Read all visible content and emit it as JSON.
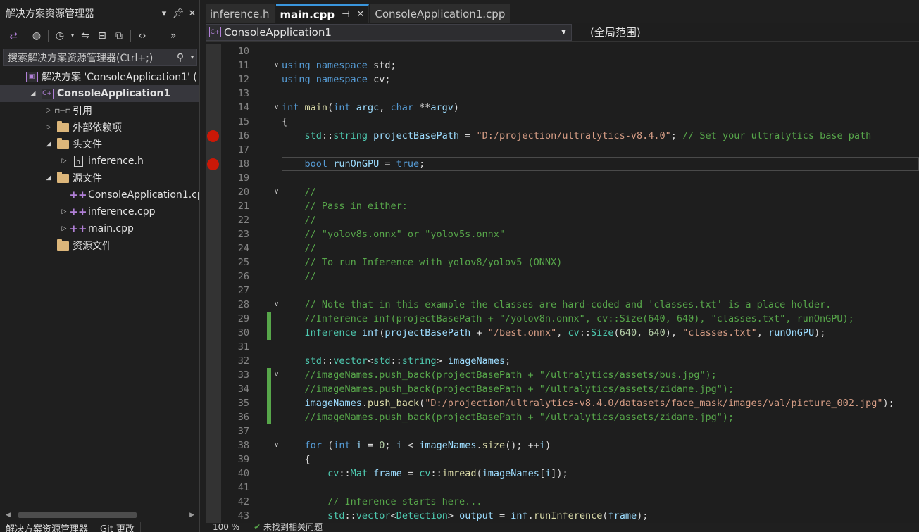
{
  "solution_explorer": {
    "title": "解决方案资源管理器",
    "search_placeholder": "搜索解决方案资源管理器(Ctrl+;)",
    "tree": [
      {
        "label": "解决方案 'ConsoleApplication1' (",
        "icon": "solution-icon",
        "indent": 0,
        "twisty": "",
        "bold": false
      },
      {
        "label": "ConsoleApplication1",
        "icon": "project-icon",
        "indent": 1,
        "twisty": "open",
        "bold": true
      },
      {
        "label": "引用",
        "icon": "references-icon",
        "indent": 2,
        "twisty": "closed",
        "bold": false
      },
      {
        "label": "外部依赖项",
        "icon": "external-deps-icon",
        "indent": 2,
        "twisty": "closed",
        "bold": false
      },
      {
        "label": "头文件",
        "icon": "folder-icon",
        "indent": 2,
        "twisty": "open",
        "bold": false
      },
      {
        "label": "inference.h",
        "icon": "header-file-icon",
        "indent": 3,
        "twisty": "closed",
        "bold": false
      },
      {
        "label": "源文件",
        "icon": "folder-icon",
        "indent": 2,
        "twisty": "open",
        "bold": false
      },
      {
        "label": "ConsoleApplication1.cp",
        "icon": "cpp-file-icon",
        "indent": 3,
        "twisty": "",
        "bold": false
      },
      {
        "label": "inference.cpp",
        "icon": "cpp-file-icon",
        "indent": 3,
        "twisty": "closed",
        "bold": false
      },
      {
        "label": "main.cpp",
        "icon": "cpp-file-icon",
        "indent": 3,
        "twisty": "closed",
        "bold": false
      },
      {
        "label": "资源文件",
        "icon": "folder-icon",
        "indent": 2,
        "twisty": "",
        "bold": false
      }
    ],
    "bottom_tabs": [
      "解决方案资源管理器",
      "Git 更改"
    ]
  },
  "editor": {
    "tabs": [
      {
        "label": "inference.h",
        "active": false
      },
      {
        "label": "main.cpp",
        "active": true
      },
      {
        "label": "ConsoleApplication1.cpp",
        "active": false
      }
    ],
    "nav_project": "ConsoleApplication1",
    "nav_scope": "(全局范围)",
    "lines": [
      {
        "n": "10",
        "indent": 0,
        "segs": []
      },
      {
        "n": "11",
        "indent": 0,
        "fold": true,
        "segs": [
          [
            "kw",
            "using"
          ],
          [
            "pl",
            " "
          ],
          [
            "kw",
            "namespace"
          ],
          [
            "pl",
            " std;"
          ]
        ]
      },
      {
        "n": "12",
        "indent": 0,
        "segs": [
          [
            "kw",
            "using"
          ],
          [
            "pl",
            " "
          ],
          [
            "kw",
            "namespace"
          ],
          [
            "pl",
            " cv;"
          ]
        ]
      },
      {
        "n": "13",
        "indent": 0,
        "segs": []
      },
      {
        "n": "14",
        "indent": 0,
        "fold": true,
        "segs": [
          [
            "kw",
            "int"
          ],
          [
            "pl",
            " "
          ],
          [
            "fn",
            "main"
          ],
          [
            "pl",
            "("
          ],
          [
            "kw",
            "int"
          ],
          [
            "pl",
            " "
          ],
          [
            "vr",
            "argc"
          ],
          [
            "pl",
            ", "
          ],
          [
            "kw",
            "char"
          ],
          [
            "pl",
            " **"
          ],
          [
            "vr",
            "argv"
          ],
          [
            "pl",
            ")"
          ]
        ]
      },
      {
        "n": "15",
        "indent": 0,
        "segs": [
          [
            "pl",
            "{"
          ]
        ]
      },
      {
        "n": "16",
        "indent": 1,
        "bp": true,
        "segs": [
          [
            "ty",
            "std"
          ],
          [
            "pl",
            "::"
          ],
          [
            "ty",
            "string"
          ],
          [
            "pl",
            " "
          ],
          [
            "vr",
            "projectBasePath"
          ],
          [
            "pl",
            " = "
          ],
          [
            "st",
            "\"D:/projection/ultralytics-v8.4.0\""
          ],
          [
            "pl",
            "; "
          ],
          [
            "cm",
            "// Set your ultralytics base path"
          ]
        ]
      },
      {
        "n": "17",
        "indent": 1,
        "segs": []
      },
      {
        "n": "18",
        "indent": 1,
        "bp": true,
        "cur": true,
        "segs": [
          [
            "kw",
            "bool"
          ],
          [
            "pl",
            " "
          ],
          [
            "vr",
            "runOnGPU"
          ],
          [
            "pl",
            " = "
          ],
          [
            "kw",
            "true"
          ],
          [
            "pl",
            ";"
          ]
        ]
      },
      {
        "n": "19",
        "indent": 1,
        "segs": []
      },
      {
        "n": "20",
        "indent": 1,
        "fold": true,
        "segs": [
          [
            "cm",
            "//"
          ]
        ]
      },
      {
        "n": "21",
        "indent": 1,
        "segs": [
          [
            "cm",
            "// Pass in either:"
          ]
        ]
      },
      {
        "n": "22",
        "indent": 1,
        "segs": [
          [
            "cm",
            "//"
          ]
        ]
      },
      {
        "n": "23",
        "indent": 1,
        "segs": [
          [
            "cm",
            "// \"yolov8s.onnx\" or \"yolov5s.onnx\""
          ]
        ]
      },
      {
        "n": "24",
        "indent": 1,
        "segs": [
          [
            "cm",
            "//"
          ]
        ]
      },
      {
        "n": "25",
        "indent": 1,
        "segs": [
          [
            "cm",
            "// To run Inference with yolov8/yolov5 (ONNX)"
          ]
        ]
      },
      {
        "n": "26",
        "indent": 1,
        "segs": [
          [
            "cm",
            "//"
          ]
        ]
      },
      {
        "n": "27",
        "indent": 1,
        "segs": []
      },
      {
        "n": "28",
        "indent": 1,
        "fold": true,
        "segs": [
          [
            "cm",
            "// Note that in this example the classes are hard-coded and 'classes.txt' is a place holder."
          ]
        ]
      },
      {
        "n": "29",
        "indent": 1,
        "chg": true,
        "segs": [
          [
            "cm",
            "//Inference inf(projectBasePath + \"/yolov8n.onnx\", cv::Size(640, 640), \"classes.txt\", runOnGPU);"
          ]
        ]
      },
      {
        "n": "30",
        "indent": 1,
        "chg": true,
        "segs": [
          [
            "ty",
            "Inference"
          ],
          [
            "pl",
            " "
          ],
          [
            "vr",
            "inf"
          ],
          [
            "pl",
            "("
          ],
          [
            "vr",
            "projectBasePath"
          ],
          [
            "pl",
            " + "
          ],
          [
            "st",
            "\"/best.onnx\""
          ],
          [
            "pl",
            ", "
          ],
          [
            "ty",
            "cv"
          ],
          [
            "pl",
            "::"
          ],
          [
            "ty",
            "Size"
          ],
          [
            "pl",
            "("
          ],
          [
            "nm",
            "640"
          ],
          [
            "pl",
            ", "
          ],
          [
            "nm",
            "640"
          ],
          [
            "pl",
            "), "
          ],
          [
            "st",
            "\"classes.txt\""
          ],
          [
            "pl",
            ", "
          ],
          [
            "vr",
            "runOnGPU"
          ],
          [
            "pl",
            ");"
          ]
        ]
      },
      {
        "n": "31",
        "indent": 1,
        "segs": []
      },
      {
        "n": "32",
        "indent": 1,
        "segs": [
          [
            "ty",
            "std"
          ],
          [
            "pl",
            "::"
          ],
          [
            "ty",
            "vector"
          ],
          [
            "pl",
            "<"
          ],
          [
            "ty",
            "std"
          ],
          [
            "pl",
            "::"
          ],
          [
            "ty",
            "string"
          ],
          [
            "pl",
            "> "
          ],
          [
            "vr",
            "imageNames"
          ],
          [
            "pl",
            ";"
          ]
        ]
      },
      {
        "n": "33",
        "indent": 1,
        "fold": true,
        "chg": true,
        "segs": [
          [
            "cm",
            "//imageNames.push_back(projectBasePath + \"/ultralytics/assets/bus.jpg\");"
          ]
        ]
      },
      {
        "n": "34",
        "indent": 1,
        "chg": true,
        "segs": [
          [
            "cm",
            "//imageNames.push_back(projectBasePath + \"/ultralytics/assets/zidane.jpg\");"
          ]
        ]
      },
      {
        "n": "35",
        "indent": 1,
        "chg": true,
        "segs": [
          [
            "vr",
            "imageNames"
          ],
          [
            "pl",
            "."
          ],
          [
            "fn",
            "push_back"
          ],
          [
            "pl",
            "("
          ],
          [
            "st",
            "\"D:/projection/ultralytics-v8.4.0/datasets/face_mask/images/val/picture_002.jpg\""
          ],
          [
            "pl",
            ");"
          ]
        ]
      },
      {
        "n": "36",
        "indent": 1,
        "chg": true,
        "segs": [
          [
            "cm",
            "//imageNames.push_back(projectBasePath + \"/ultralytics/assets/zidane.jpg\");"
          ]
        ]
      },
      {
        "n": "37",
        "indent": 1,
        "segs": []
      },
      {
        "n": "38",
        "indent": 1,
        "fold": true,
        "segs": [
          [
            "kw",
            "for"
          ],
          [
            "pl",
            " ("
          ],
          [
            "kw",
            "int"
          ],
          [
            "pl",
            " "
          ],
          [
            "vr",
            "i"
          ],
          [
            "pl",
            " = "
          ],
          [
            "nm",
            "0"
          ],
          [
            "pl",
            "; "
          ],
          [
            "vr",
            "i"
          ],
          [
            "pl",
            " < "
          ],
          [
            "vr",
            "imageNames"
          ],
          [
            "pl",
            "."
          ],
          [
            "fn",
            "size"
          ],
          [
            "pl",
            "(); ++"
          ],
          [
            "vr",
            "i"
          ],
          [
            "pl",
            ")"
          ]
        ]
      },
      {
        "n": "39",
        "indent": 1,
        "segs": [
          [
            "pl",
            "{"
          ]
        ]
      },
      {
        "n": "40",
        "indent": 2,
        "segs": [
          [
            "ty",
            "cv"
          ],
          [
            "pl",
            "::"
          ],
          [
            "ty",
            "Mat"
          ],
          [
            "pl",
            " "
          ],
          [
            "vr",
            "frame"
          ],
          [
            "pl",
            " = "
          ],
          [
            "ty",
            "cv"
          ],
          [
            "pl",
            "::"
          ],
          [
            "fn",
            "imread"
          ],
          [
            "pl",
            "("
          ],
          [
            "vr",
            "imageNames"
          ],
          [
            "pl",
            "["
          ],
          [
            "vr",
            "i"
          ],
          [
            "pl",
            "]);"
          ]
        ]
      },
      {
        "n": "41",
        "indent": 2,
        "segs": []
      },
      {
        "n": "42",
        "indent": 2,
        "segs": [
          [
            "cm",
            "// Inference starts here..."
          ]
        ]
      },
      {
        "n": "43",
        "indent": 2,
        "segs": [
          [
            "ty",
            "std"
          ],
          [
            "pl",
            "::"
          ],
          [
            "ty",
            "vector"
          ],
          [
            "pl",
            "<"
          ],
          [
            "ty",
            "Detection"
          ],
          [
            "pl",
            "> "
          ],
          [
            "vr",
            "output"
          ],
          [
            "pl",
            " = "
          ],
          [
            "vr",
            "inf"
          ],
          [
            "pl",
            "."
          ],
          [
            "fn",
            "runInference"
          ],
          [
            "pl",
            "("
          ],
          [
            "vr",
            "frame"
          ],
          [
            "pl",
            ");"
          ]
        ]
      }
    ],
    "status": {
      "zoom": "100 %",
      "issues": "未找到相关问题"
    }
  }
}
